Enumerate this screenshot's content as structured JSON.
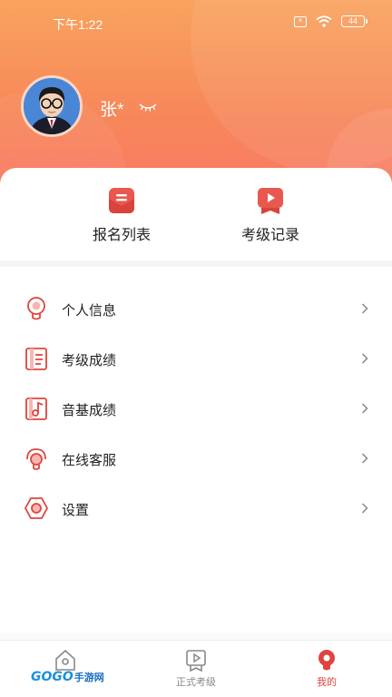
{
  "status_bar": {
    "time": "下午1:22",
    "battery": "44",
    "icons": [
      "sim-off-icon",
      "wifi-icon",
      "battery-icon"
    ]
  },
  "profile": {
    "name": "张*",
    "avatar": "avatar-photo",
    "visibility_icon": "eye-closed-icon"
  },
  "quick_actions": [
    {
      "label": "报名列表",
      "icon": "mail-list-icon"
    },
    {
      "label": "考级记录",
      "icon": "play-ribbon-icon"
    }
  ],
  "menu": [
    {
      "label": "个人信息",
      "icon": "lightbulb-icon"
    },
    {
      "label": "考级成绩",
      "icon": "document-icon"
    },
    {
      "label": "音基成绩",
      "icon": "music-note-icon"
    },
    {
      "label": "在线客服",
      "icon": "headset-icon"
    },
    {
      "label": "设置",
      "icon": "hexagon-settings-icon"
    }
  ],
  "tabs": [
    {
      "label": "",
      "icon": "home-icon",
      "active": false
    },
    {
      "label": "正式考级",
      "icon": "play-board-icon",
      "active": false
    },
    {
      "label": "我的",
      "icon": "profile-bulb-icon",
      "active": true
    }
  ],
  "watermark": {
    "logo": "GOGO",
    "text": "手游网"
  },
  "colors": {
    "accent": "#e0443e",
    "header_top": "#f9a35e",
    "header_bottom": "#f87863"
  }
}
